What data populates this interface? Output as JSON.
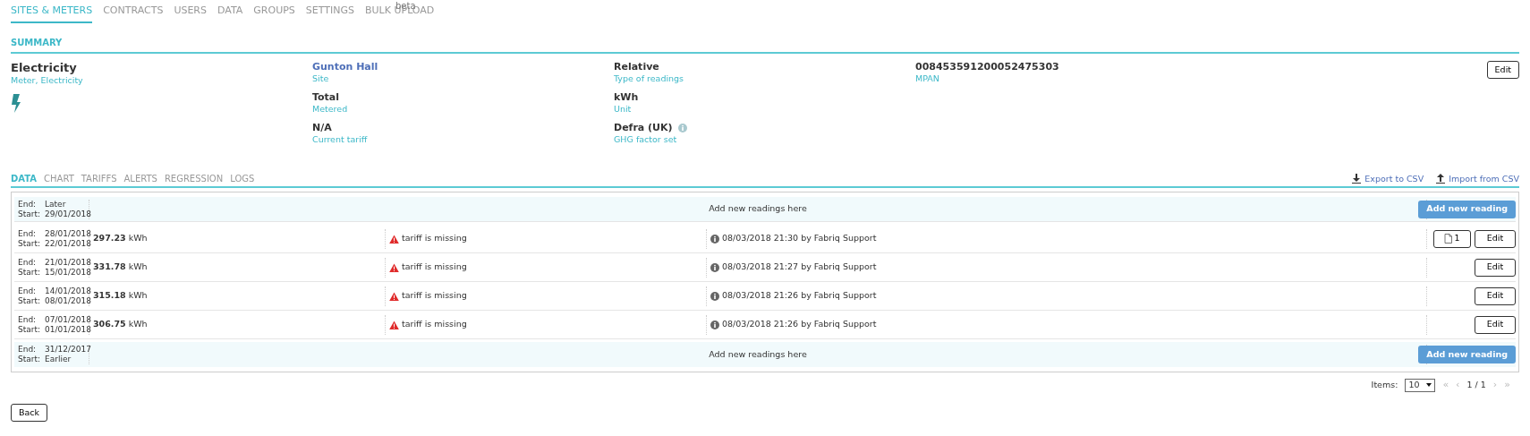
{
  "nav": {
    "tabs": [
      {
        "label": "SITES & METERS",
        "selected": true
      },
      {
        "label": "CONTRACTS",
        "selected": false
      },
      {
        "label": "USERS",
        "selected": false
      },
      {
        "label": "DATA",
        "selected": false
      },
      {
        "label": "GROUPS",
        "selected": false
      },
      {
        "label": "SETTINGS",
        "selected": false
      },
      {
        "label": "BULK UPLOAD",
        "selected": false,
        "badge": "beta"
      }
    ]
  },
  "summary": {
    "title": "SUMMARY",
    "meter": {
      "name": "Electricity",
      "subtitle": "Meter, Electricity"
    },
    "columns": [
      [
        {
          "value": "Gunton Hall",
          "label": "Site",
          "link": true
        },
        {
          "value": "Total",
          "label": "Metered"
        },
        {
          "value": "N/A",
          "label": "Current tariff"
        }
      ],
      [
        {
          "value": "Relative",
          "label": "Type of readings"
        },
        {
          "value": "kWh",
          "label": "Unit"
        },
        {
          "value": "Defra (UK)",
          "label": "GHG factor set",
          "info": true
        }
      ],
      [
        {
          "value": "008453591200052475303",
          "label": "MPAN"
        }
      ]
    ],
    "edit_button": "Edit"
  },
  "data_tabs": [
    {
      "label": "DATA",
      "selected": true
    },
    {
      "label": "CHART",
      "selected": false
    },
    {
      "label": "TARIFFS",
      "selected": false
    },
    {
      "label": "ALERTS",
      "selected": false
    },
    {
      "label": "REGRESSION",
      "selected": false
    },
    {
      "label": "LOGS",
      "selected": false
    }
  ],
  "actions": [
    {
      "label": "Export to CSV",
      "kind": "export"
    },
    {
      "label": "Import from CSV",
      "kind": "import"
    }
  ],
  "readings": [
    {
      "kind": "placeholder",
      "end_label": "End:",
      "end": "Later",
      "start_label": "Start:",
      "start": "29/01/2018",
      "message": "Add new readings here",
      "button": "Add new reading"
    },
    {
      "kind": "reading",
      "end_label": "End:",
      "end": "28/01/2018",
      "start_label": "Start:",
      "start": "22/01/2018",
      "value": "297.23",
      "unit": "kWh",
      "warning": "tariff is missing",
      "log": "08/03/2018 21:30 by Fabriq Support",
      "attachments": "1",
      "button": "Edit"
    },
    {
      "kind": "reading",
      "end_label": "End:",
      "end": "21/01/2018",
      "start_label": "Start:",
      "start": "15/01/2018",
      "value": "331.78",
      "unit": "kWh",
      "warning": "tariff is missing",
      "log": "08/03/2018 21:27 by Fabriq Support",
      "button": "Edit"
    },
    {
      "kind": "reading",
      "end_label": "End:",
      "end": "14/01/2018",
      "start_label": "Start:",
      "start": "08/01/2018",
      "value": "315.18",
      "unit": "kWh",
      "warning": "tariff is missing",
      "log": "08/03/2018 21:26 by Fabriq Support",
      "button": "Edit"
    },
    {
      "kind": "reading",
      "end_label": "End:",
      "end": "07/01/2018",
      "start_label": "Start:",
      "start": "01/01/2018",
      "value": "306.75",
      "unit": "kWh",
      "warning": "tariff is missing",
      "log": "08/03/2018 21:26 by Fabriq Support",
      "button": "Edit"
    },
    {
      "kind": "placeholder",
      "end_label": "End:",
      "end": "31/12/2017",
      "start_label": "Start:",
      "start": "Earlier",
      "message": "Add new readings here",
      "button": "Add new reading"
    }
  ],
  "pagination": {
    "items_label": "Items:",
    "page_size": "10",
    "page": "1 / 1",
    "controls": [
      {
        "label": "«",
        "disabled": true
      },
      {
        "label": "‹",
        "disabled": true
      },
      {
        "label": "›",
        "disabled": true
      },
      {
        "label": "»",
        "disabled": true
      }
    ]
  },
  "back_button": "Back"
}
